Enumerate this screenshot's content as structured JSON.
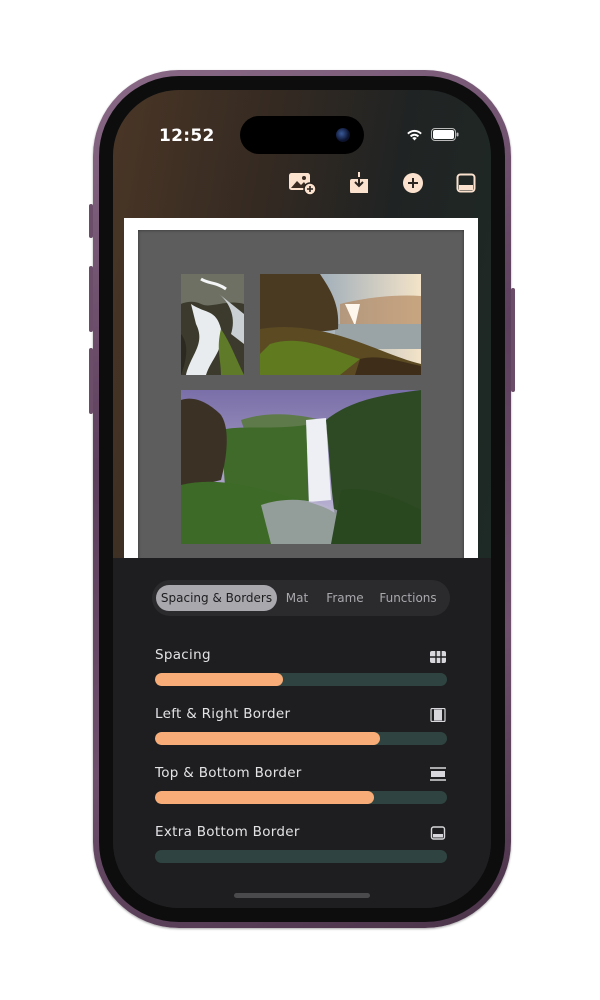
{
  "status_bar": {
    "time": "12:52"
  },
  "toolbar": {
    "items": [
      {
        "icon": "add-photo-icon"
      },
      {
        "icon": "download-icon"
      },
      {
        "icon": "plus-circle-icon"
      },
      {
        "icon": "bottom-panel-icon"
      }
    ]
  },
  "tabs": {
    "items": [
      "Spacing & Borders",
      "Mat",
      "Frame",
      "Functions"
    ],
    "selected": "Spacing & Borders"
  },
  "sliders": [
    {
      "label": "Spacing",
      "icon": "grid-spacing-icon",
      "value": 0.44
    },
    {
      "label": "Left & Right Border",
      "icon": "side-border-icon",
      "value": 0.77
    },
    {
      "label": "Top & Bottom Border",
      "icon": "top-bottom-border-icon",
      "value": 0.75
    },
    {
      "label": "Extra Bottom Border",
      "icon": "extra-bottom-border-icon",
      "value": 0.0
    }
  ],
  "colors": {
    "accent": "#f8ad78",
    "track": "#2f4440",
    "mat": "#5d5d5d"
  }
}
